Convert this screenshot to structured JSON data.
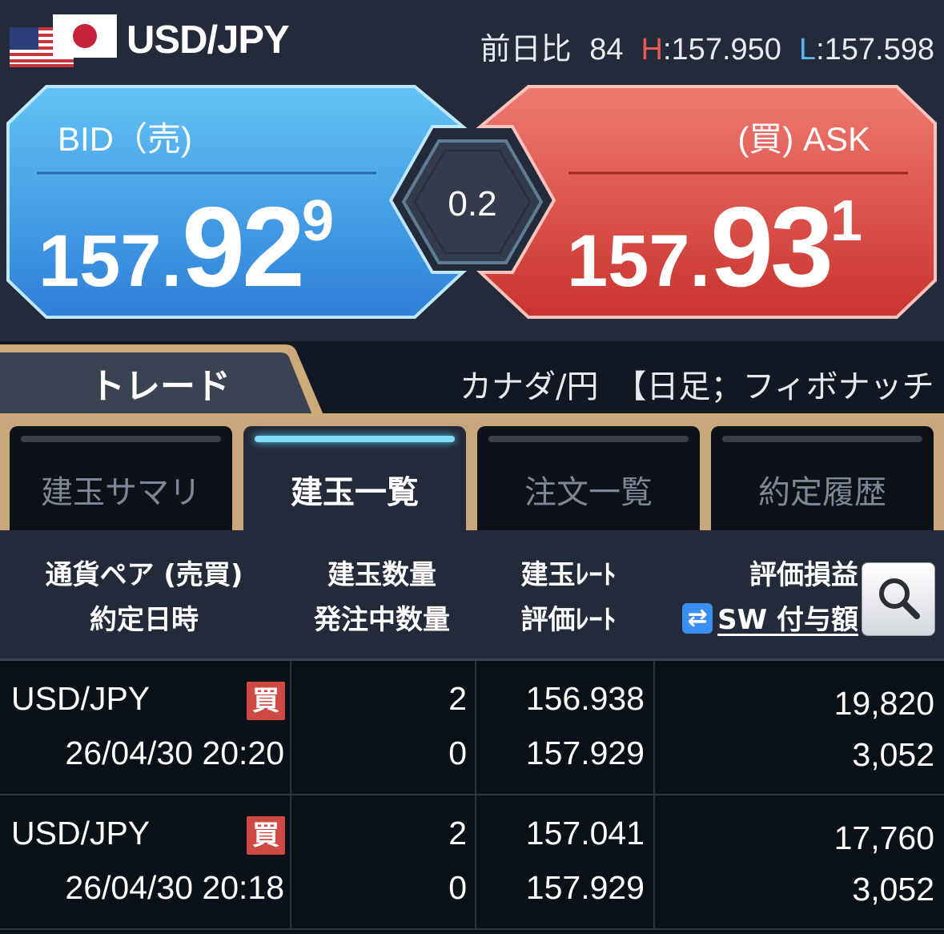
{
  "header": {
    "pair": "USD/JPY",
    "change_label": "前日比",
    "change_value": "84",
    "high_label": "H",
    "high_value": "157.950",
    "low_label": "L",
    "low_value": "157.598"
  },
  "quote": {
    "bid_label": "BID（売)",
    "ask_label": "(買) ASK",
    "bid_prefix": "157.",
    "bid_big": "92",
    "bid_pip": "9",
    "ask_prefix": "157.",
    "ask_big": "93",
    "ask_pip": "1",
    "spread": "0.2",
    "colors": {
      "bid": "#3c9be6",
      "ask": "#d8463f"
    }
  },
  "trade_tab": {
    "label": "トレード",
    "ticker": "カナダ/円　【日足；フィボナッチ"
  },
  "subtabs": [
    {
      "label": "建玉サマリ",
      "active": false
    },
    {
      "label": "建玉一覧",
      "active": true
    },
    {
      "label": "注文一覧",
      "active": false
    },
    {
      "label": "約定履歴",
      "active": false
    }
  ],
  "columns": {
    "c1_line1": "通貨ペア (売買)",
    "c1_line2": "約定日時",
    "c2_line1": "建玉数量",
    "c2_line2": "発注中数量",
    "c3_line1": "建玉ﾚｰﾄ",
    "c3_line2": "評価ﾚｰﾄ",
    "c4_line1": "評価損益",
    "c4_line2": "SW 付与額",
    "swap_icon": "swap-arrows-icon",
    "search_icon": "search-icon"
  },
  "rows": [
    {
      "pair": "USD/JPY",
      "side": "買",
      "datetime": "26/04/30 20:20",
      "qty": "2",
      "pending_qty": "0",
      "open_rate": "156.938",
      "eval_rate": "157.929",
      "pnl": "19,820",
      "swap": "3,052"
    },
    {
      "pair": "USD/JPY",
      "side": "買",
      "datetime": "26/04/30 20:18",
      "qty": "2",
      "pending_qty": "0",
      "open_rate": "157.041",
      "eval_rate": "157.929",
      "pnl": "17,760",
      "swap": "3,052"
    }
  ]
}
